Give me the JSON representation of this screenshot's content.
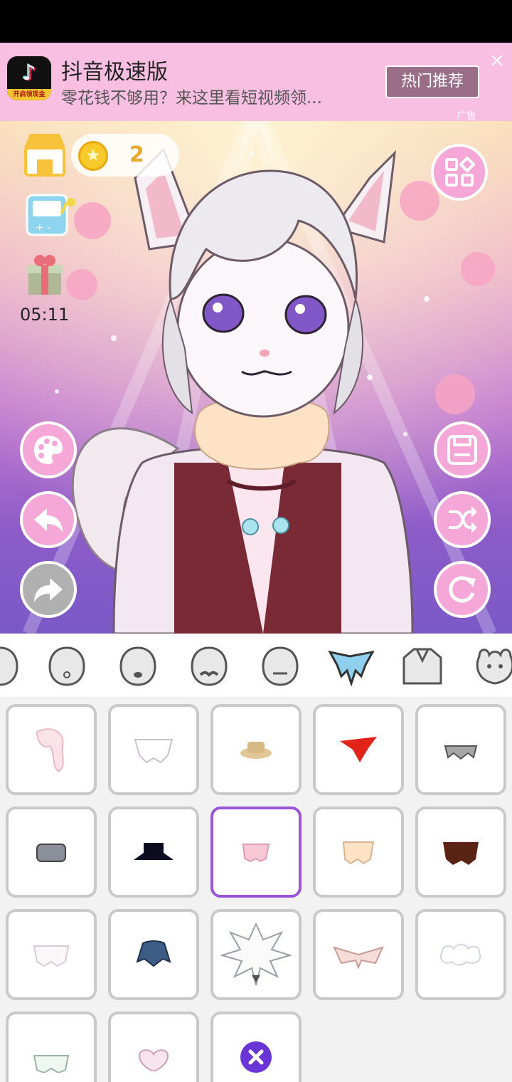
{
  "ad": {
    "title": "抖音极速版",
    "description": "零花钱不够用？来这里看短视频领...",
    "cta": "热门推荐",
    "close": "×",
    "tag": "广告",
    "logo_strip": "开启领现金"
  },
  "hud": {
    "coins": "2",
    "timer": "05:11"
  },
  "categories": [
    "face-partial",
    "face-mouth",
    "face-open-mouth",
    "face-mustache",
    "face-smile",
    "collar",
    "shirt",
    "pet"
  ],
  "items": {
    "selected_index": 7,
    "remove_label": "×",
    "list": [
      {
        "name": "pink-scarf"
      },
      {
        "name": "white-fur-collar"
      },
      {
        "name": "straw-hat"
      },
      {
        "name": "red-bandana"
      },
      {
        "name": "gray-hair-piece"
      },
      {
        "name": "gray-armor-collar"
      },
      {
        "name": "black-turtleneck"
      },
      {
        "name": "pink-fur-collar"
      },
      {
        "name": "cream-fur-collar"
      },
      {
        "name": "brown-fur-collar"
      },
      {
        "name": "white-fluff-collar"
      },
      {
        "name": "blue-hood"
      },
      {
        "name": "white-feather-ruff"
      },
      {
        "name": "pink-bow-collar"
      },
      {
        "name": "white-cloud-collar"
      },
      {
        "name": "mint-fur-collar"
      },
      {
        "name": "pink-heart-collar"
      },
      {
        "name": "remove-item"
      }
    ]
  },
  "colors": {
    "accent_pink": "#f5a8d7",
    "selected_border": "#9b55d8",
    "coin": "#f7c92a",
    "remove": "#6a35d6"
  }
}
